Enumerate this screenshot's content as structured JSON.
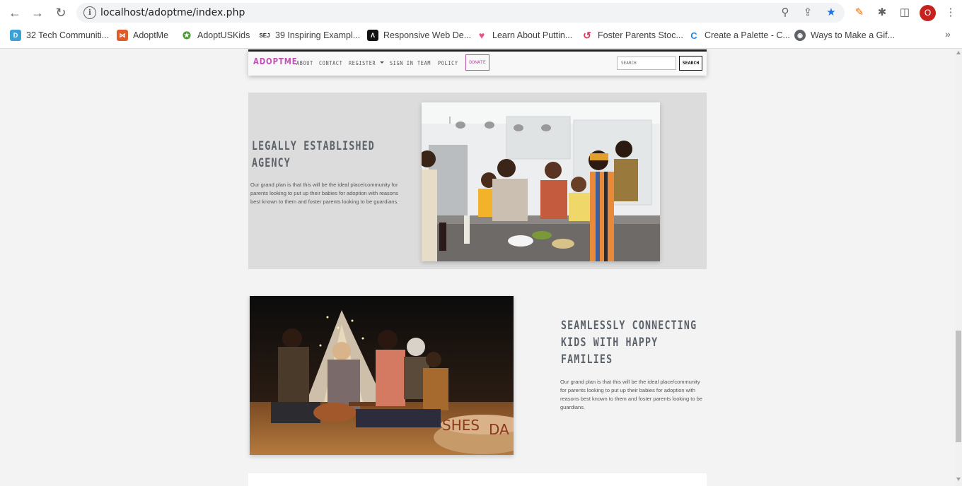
{
  "browser": {
    "url": "localhost/adoptme/index.php",
    "avatar_letter": "O",
    "bookmarks": [
      {
        "label": "32 Tech Communiti...",
        "icon": "blue-square-icon",
        "color": "#3aa1d9"
      },
      {
        "label": "AdoptMe",
        "icon": "xampp-icon",
        "color": "#e05a2a"
      },
      {
        "label": "AdoptUSKids",
        "icon": "person-star-icon",
        "color": "#4f9a37"
      },
      {
        "label": "39 Inspiring Exampl...",
        "icon": "sej-icon",
        "color": "#222222"
      },
      {
        "label": "Responsive Web De...",
        "icon": "responsive-icon",
        "color": "#111111"
      },
      {
        "label": "Learn About Puttin...",
        "icon": "heart-icon",
        "color": "#e75480"
      },
      {
        "label": "Foster Parents Stoc...",
        "icon": "spiral-icon",
        "color": "#e8315a"
      },
      {
        "label": "Create a Palette - C...",
        "icon": "coolors-icon",
        "color": "#1e8bf0"
      },
      {
        "label": "Ways to Make a Gif...",
        "icon": "globe-icon",
        "color": "#5f6368"
      }
    ]
  },
  "site": {
    "logo": "ADOPTME",
    "nav": {
      "about": "ABOUT",
      "contact": "CONTACT",
      "register": "REGISTER",
      "sign_in": "SIGN IN",
      "team": "TEAM",
      "policy": "POLICY",
      "donate": "DONATE",
      "search_placeholder": "SEARCH",
      "search_button": "SEARCH"
    },
    "brand_color": "#c052b5",
    "sections": [
      {
        "heading_line1": "LEGALLY ESTABLISHED",
        "heading_line2": "AGENCY",
        "text": "Our grand plan is that this will be the ideal place/community for parents looking to put up their babies for adoption with reasons best known to them and foster parents looking to be guardians."
      },
      {
        "heading_line1": "SEAMLESSLY CONNECTING",
        "heading_line2": "KIDS WITH HAPPY",
        "heading_line3": "FAMILIES",
        "text": "Our grand plan is that this will be the ideal place/community for parents looking to put up their babies for adoption with reasons best known to them and foster parents looking to be guardians."
      }
    ]
  }
}
